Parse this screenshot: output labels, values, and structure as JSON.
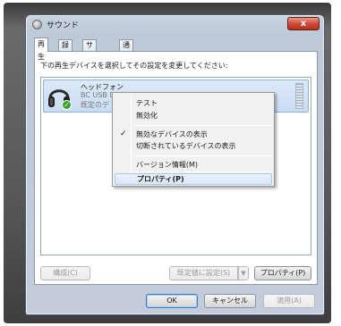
{
  "window": {
    "title": "サウンド",
    "close_glyph": "x"
  },
  "tabs": [
    {
      "label": "再生",
      "active": true
    },
    {
      "label": "録音",
      "active": false
    },
    {
      "label": "サウンド",
      "active": false
    },
    {
      "label": "通信",
      "active": false
    }
  ],
  "panel": {
    "instruction": "下の再生デバイスを選択してその設定を変更してください:"
  },
  "device": {
    "name": "ヘッドフォン",
    "description": "BC USB DAC",
    "status": "既定のデ",
    "icon": "headphones-icon",
    "badge": "✓"
  },
  "context_menu": {
    "items": [
      {
        "label": "テスト",
        "checked": false,
        "highlight": false
      },
      {
        "label": "無効化",
        "checked": false,
        "highlight": false
      },
      {
        "label": "無効なデバイスの表示",
        "checked": true,
        "highlight": false
      },
      {
        "label": "切断されているデバイスの表示",
        "checked": false,
        "highlight": false
      },
      {
        "label": "バージョン情報(M)",
        "checked": false,
        "highlight": false
      },
      {
        "label": "プロパティ(P)",
        "checked": false,
        "highlight": true
      }
    ],
    "check_glyph": "✓"
  },
  "panel_buttons": {
    "configure": "構成(C)",
    "set_default": "既定値に設定(S)",
    "split_arrow": "▼",
    "properties": "プロパティ(P)"
  },
  "dialog_buttons": {
    "ok": "OK",
    "cancel": "キャンセル",
    "apply": "適用(A)"
  },
  "colors": {
    "selection": "#c9ddf3",
    "close": "#cf4b35",
    "badge": "#3aa02c"
  }
}
